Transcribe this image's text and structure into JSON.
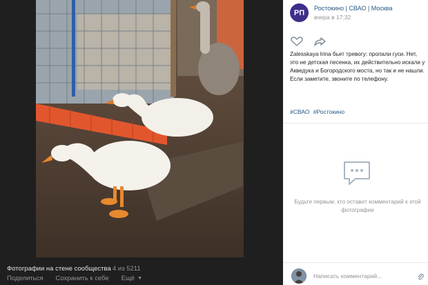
{
  "viewer": {
    "album_title": "Фотографии на стене сообщества",
    "counter": "4 из 5211",
    "actions": {
      "share": "Поделиться",
      "save": "Сохранить к себе",
      "more": "Ещё"
    }
  },
  "post": {
    "avatar_text": "РП",
    "group_name": "Ростокино | СВАО | Москва",
    "time": "вчера в 17:32",
    "text": "Zalesskaya Irina бьет тревогу: пропали гуси. Нет, это не детская песенка, их действительно искали у Акведука и Богородского моста, но так и не нашли. Если заметите, звоните по телефону.",
    "tags": [
      "#СВАО",
      "#Ростокино"
    ]
  },
  "comments": {
    "empty_text": "Будьте первым, кто оставит комментарий к этой фотографии",
    "input_placeholder": "Написать комментарий..."
  },
  "colors": {
    "link": "#2a5885",
    "muted": "#939393",
    "viewer_bg": "#1f1f1f",
    "avatar_bg": "#3d2f8a"
  }
}
